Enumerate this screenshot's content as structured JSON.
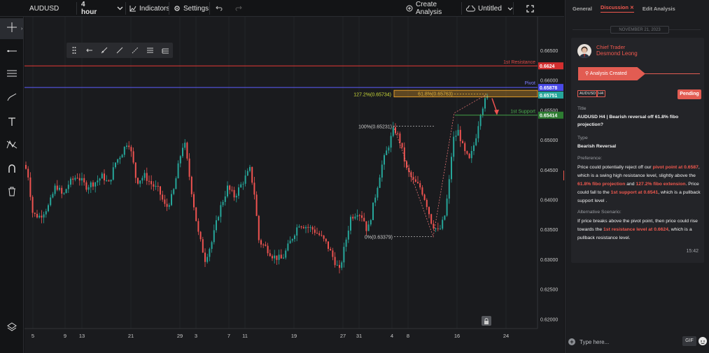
{
  "topbar": {
    "symbol": "AUDUSD",
    "interval": "4 hour",
    "indicators_label": "Indicators",
    "settings_label": "Settings",
    "create_analysis_label": "Create Analysis",
    "untitled_label": "Untitled"
  },
  "chart": {
    "price_ticks": [
      "0.66500",
      "0.66000",
      "0.65500",
      "0.65000",
      "0.64500",
      "0.64000",
      "0.63500",
      "0.63000",
      "0.62500",
      "0.62000"
    ],
    "date_ticks": [
      "5",
      "9",
      "13",
      "21",
      "29",
      "3",
      "7",
      "11",
      "19",
      "27",
      "31",
      "4",
      "8",
      "16",
      "24"
    ],
    "lines": {
      "resistance_label": "1st Resistance",
      "resistance_value": "0.6624",
      "pivot_label": "Pivot",
      "pivot_value": "0.65878",
      "current_value": "0.65751",
      "support_label": "1st Support",
      "support_value": "0.65414"
    },
    "fib": {
      "ext_label": "127.2%(0.65734)",
      "ret_label": "61.8%(0.65763)",
      "high_label": "100%(0.65231)",
      "low_label": "0%(0.63379)"
    },
    "colors": {
      "up": "#26a69a",
      "down": "#ef5350",
      "resistance": "#e53935",
      "pivot": "#5c5cff",
      "support": "#43a047",
      "fib": "#e09b2a"
    }
  },
  "panel": {
    "tabs": [
      "General",
      "Discussion",
      "Edit Analysis"
    ],
    "date_divider": "NOVEMBER 21, 2023",
    "author_role": "Chief Trader",
    "author_name": "Desmond Leong",
    "status_ribbon": "Analysis Created",
    "chip_symbol": "AUDUSD",
    "chip_tf": "H4",
    "pending_label": "Pending",
    "title_label": "Title",
    "title_value": "AUDUSD H4 | Bearish reversal off 61.8% fibo projection?",
    "type_label": "Type",
    "type_value": "Bearish Reversal",
    "pref_label": "Preference:",
    "pref_1": "Price could potentially reject off our ",
    "pref_2": "pivot point at 0.6587",
    "pref_3": ", which is a swing high resistance level, slightly above the ",
    "pref_4": "61.8% fibo projection",
    "pref_5": " and ",
    "pref_6": "127.2% fibo extension",
    "pref_7": ". Price could fall to the ",
    "pref_8": "1st support at 0.6541",
    "pref_9": ", which is a pullback support level .",
    "alt_label": "Alternative Scenario:",
    "alt_1": "If price breaks above the pivot point, then price could rise towards the ",
    "alt_2": "1st resistance level at 0.6624",
    "alt_3": ", which is a pullback resistance level.",
    "timestamp": "15:42",
    "input_placeholder": "Type here...",
    "gif_label": "GIF"
  }
}
